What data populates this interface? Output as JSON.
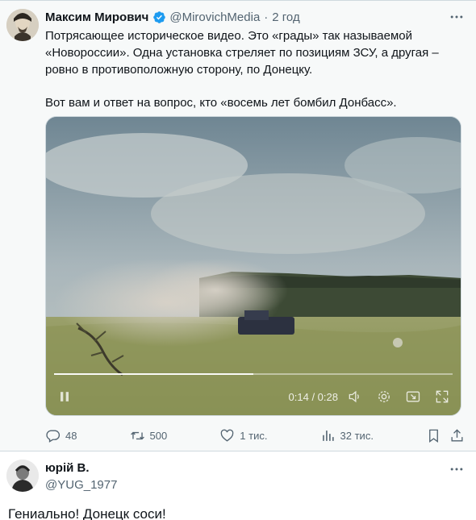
{
  "quoted_tweet": {
    "author_name": "Максим Мирович",
    "handle": "@MirovichMedia",
    "separator": "·",
    "time": "2 год",
    "text_paragraphs": [
      "Потрясающее историческое видео. Это «грады» так называемой «Новороссии». Одна установка стреляет по позициям ЗСУ, а другая – ровно в противоположную сторону, по Донецку.",
      "Вот вам и ответ на вопрос, кто «восемь лет бомбил Донбасс»."
    ],
    "video": {
      "time_readout": "0:14 / 0:28",
      "progress": 0.5
    },
    "actions": {
      "replies": "48",
      "reposts": "500",
      "likes": "1 тис.",
      "views": "32 тис."
    }
  },
  "reply": {
    "author_name": "юрій В.",
    "handle": "@YUG_1977",
    "text": "Гениально! Донецк соси!"
  },
  "colors": {
    "text_primary": "#0f1419",
    "text_secondary": "#536471",
    "verified_blue": "#1d9bf0",
    "card_bg": "#f7f9f9"
  },
  "icons": {
    "verified": "verified-badge-icon",
    "more": "more-dots-icon",
    "reply": "reply-icon",
    "repost": "repost-icon",
    "like": "heart-icon",
    "views": "views-bar-icon",
    "bookmark": "bookmark-icon",
    "share": "share-icon",
    "play": "pause-icon",
    "volume": "volume-icon",
    "settings": "settings-gear-icon",
    "pip": "picture-in-picture-icon",
    "fullscreen": "fullscreen-icon"
  }
}
